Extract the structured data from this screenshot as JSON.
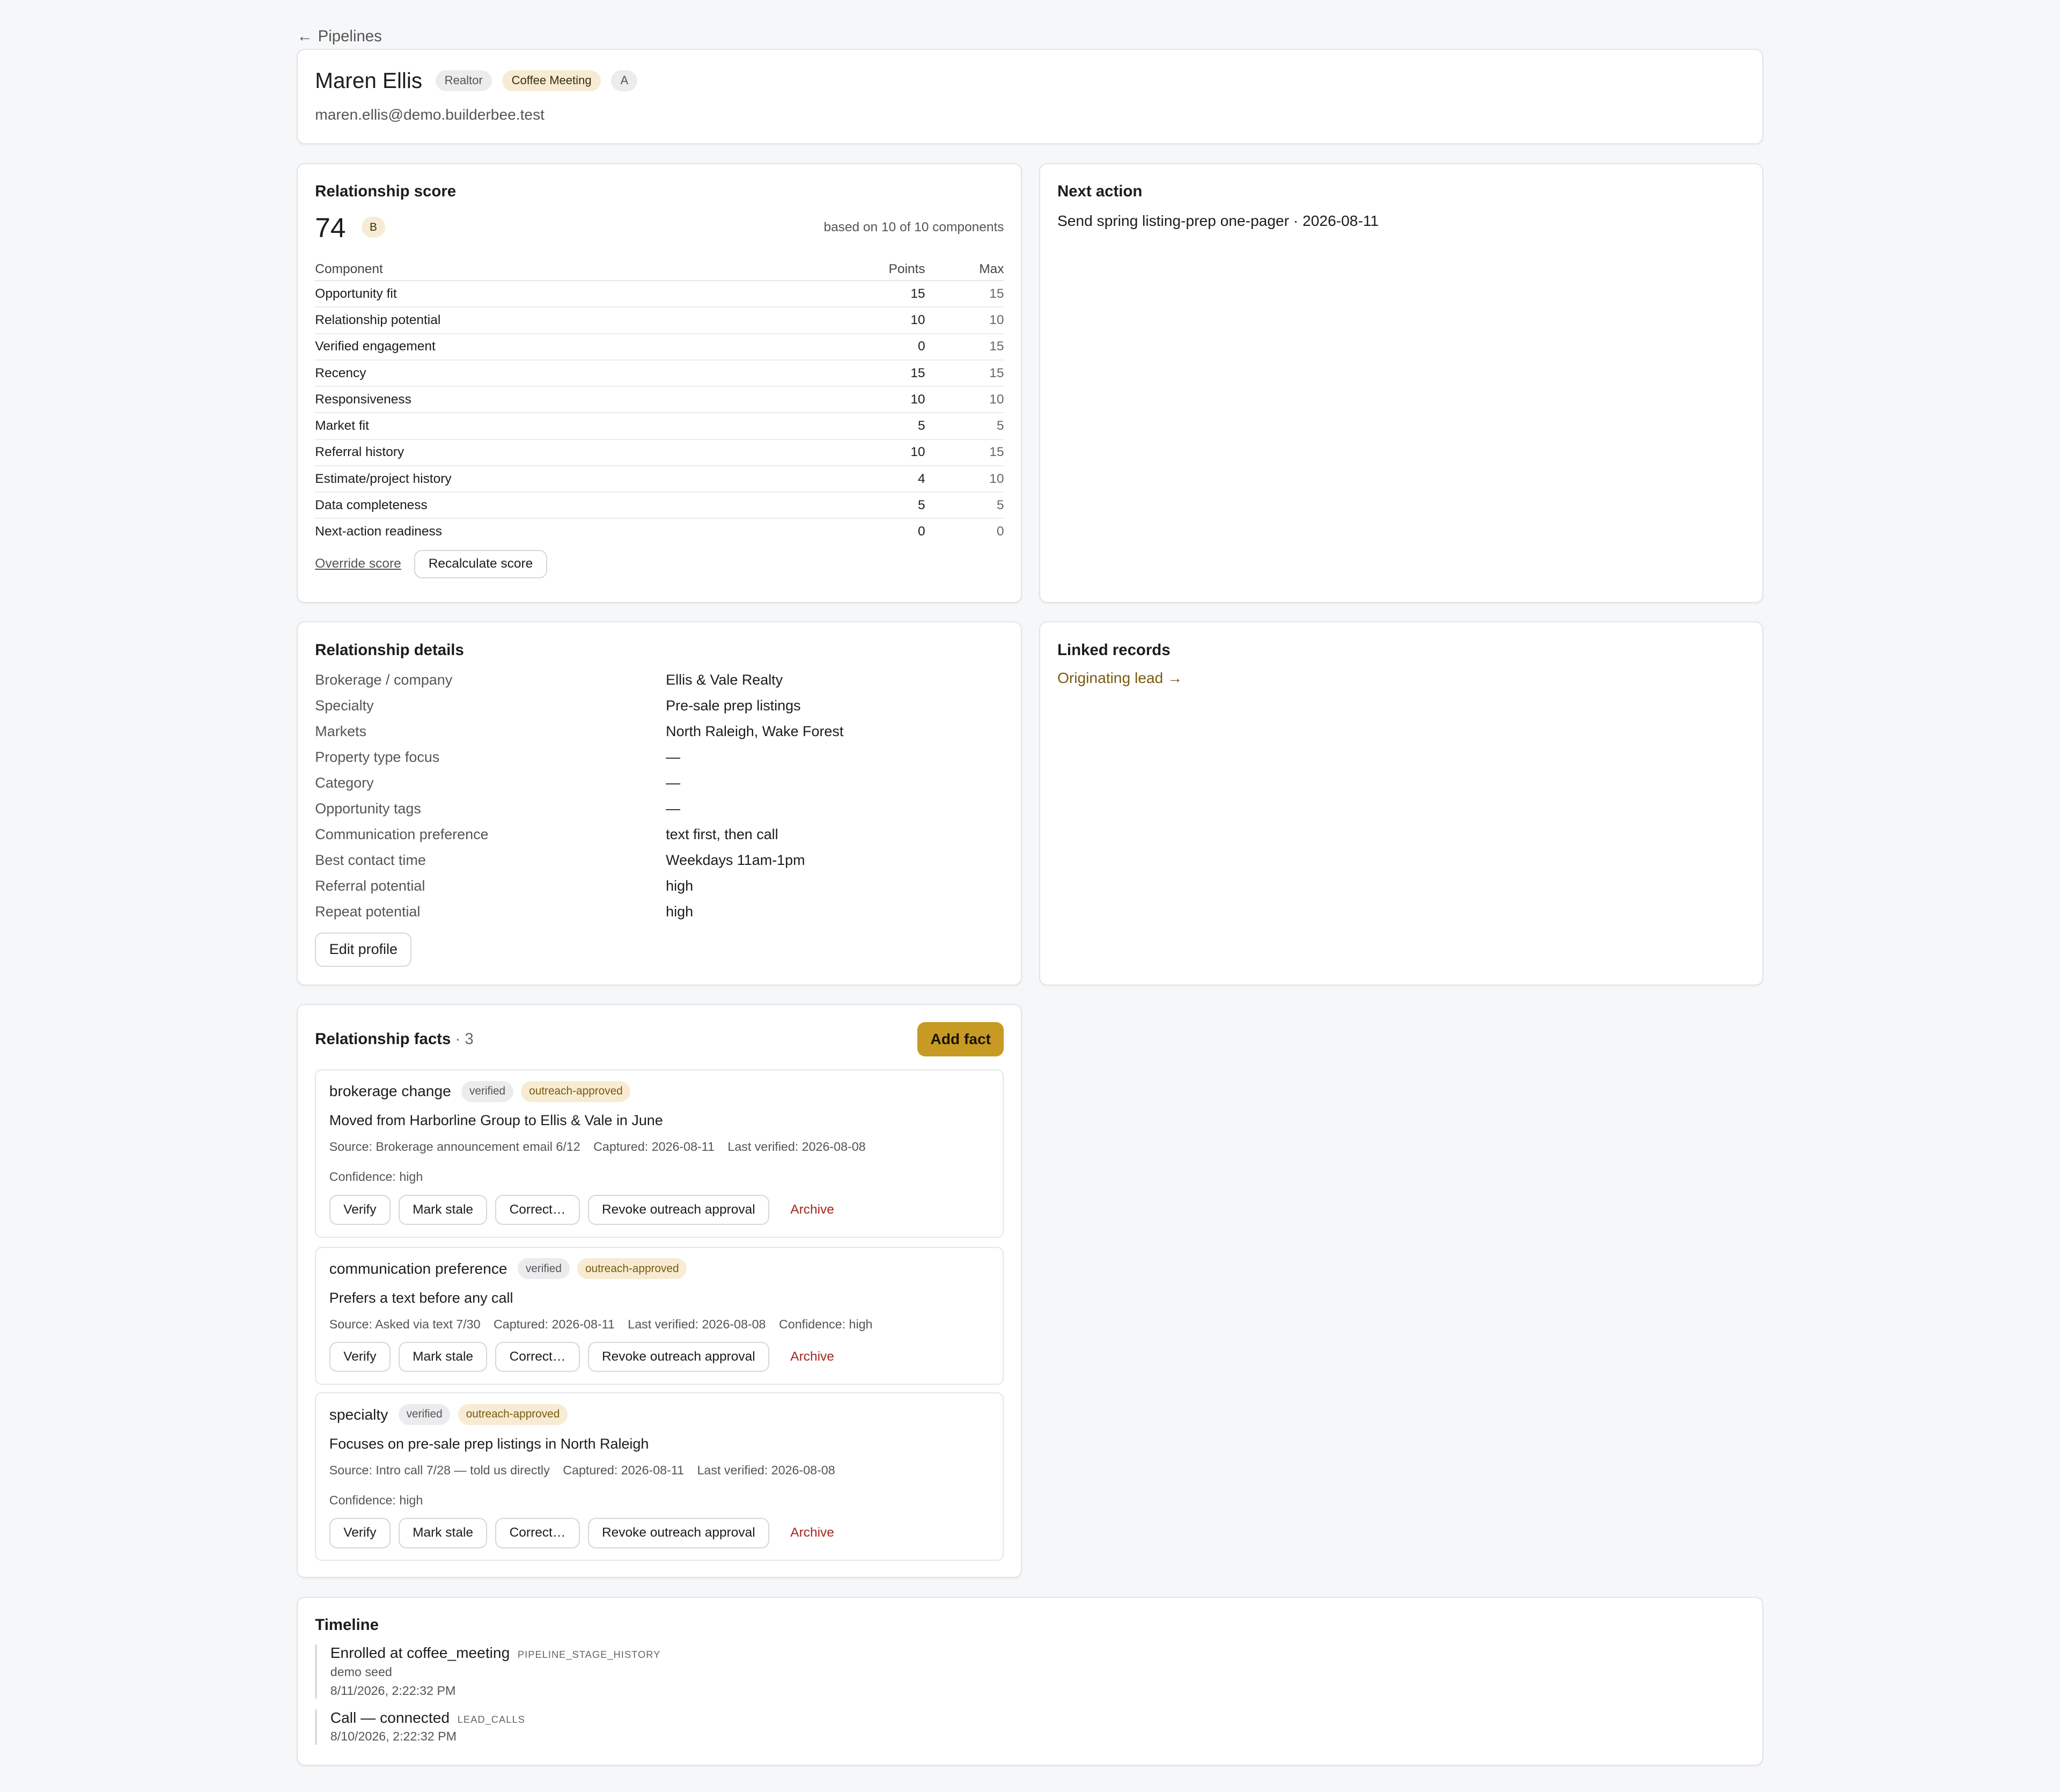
{
  "nav": {
    "back_label": "Pipelines",
    "back_icon": "arrow-left-icon"
  },
  "contact": {
    "name": "Maren Ellis",
    "role_badge": "Realtor",
    "stage_badge": "Coffee Meeting",
    "tier_badge": "A",
    "email": "maren.ellis@demo.builderbee.test"
  },
  "score": {
    "title": "Relationship score",
    "value": "74",
    "grade": "B",
    "based_on": "based on 10 of 10 components",
    "headers": {
      "component": "Component",
      "points": "Points",
      "max": "Max"
    },
    "rows": [
      {
        "component": "Opportunity fit",
        "points": "15",
        "max": "15"
      },
      {
        "component": "Relationship potential",
        "points": "10",
        "max": "10"
      },
      {
        "component": "Verified engagement",
        "points": "0",
        "max": "15"
      },
      {
        "component": "Recency",
        "points": "15",
        "max": "15"
      },
      {
        "component": "Responsiveness",
        "points": "10",
        "max": "10"
      },
      {
        "component": "Market fit",
        "points": "5",
        "max": "5"
      },
      {
        "component": "Referral history",
        "points": "10",
        "max": "15"
      },
      {
        "component": "Estimate/project history",
        "points": "4",
        "max": "10"
      },
      {
        "component": "Data completeness",
        "points": "5",
        "max": "5"
      },
      {
        "component": "Next-action readiness",
        "points": "0",
        "max": "0"
      }
    ],
    "override_label": "Override score",
    "recalculate_label": "Recalculate score"
  },
  "next_action": {
    "title": "Next action",
    "text": "Send spring listing-prep one-pager · 2026-08-11"
  },
  "details": {
    "title": "Relationship details",
    "rows": [
      {
        "label": "Brokerage / company",
        "value": "Ellis & Vale Realty"
      },
      {
        "label": "Specialty",
        "value": "Pre-sale prep listings"
      },
      {
        "label": "Markets",
        "value": "North Raleigh, Wake Forest"
      },
      {
        "label": "Property type focus",
        "value": "—"
      },
      {
        "label": "Category",
        "value": "—"
      },
      {
        "label": "Opportunity tags",
        "value": "—"
      },
      {
        "label": "Communication preference",
        "value": "text first, then call"
      },
      {
        "label": "Best contact time",
        "value": "Weekdays 11am-1pm"
      },
      {
        "label": "Referral potential",
        "value": "high"
      },
      {
        "label": "Repeat potential",
        "value": "high"
      }
    ],
    "edit_label": "Edit profile"
  },
  "linked": {
    "title": "Linked records",
    "link_label": "Originating lead →"
  },
  "facts": {
    "title": "Relationship facts",
    "count": "· 3",
    "add_label": "Add fact",
    "action_labels": {
      "verify": "Verify",
      "stale": "Mark stale",
      "correct": "Correct…",
      "revoke": "Revoke outreach approval",
      "archive": "Archive"
    },
    "items": [
      {
        "title": "brokerage change",
        "badge1": "verified",
        "badge2": "outreach-approved",
        "text": "Moved from Harborline Group to Ellis & Vale in June",
        "source": "Source: Brokerage announcement email 6/12",
        "captured": "Captured: 2026-08-11",
        "verified": "Last verified: 2026-08-08",
        "confidence": "Confidence: high"
      },
      {
        "title": "communication preference",
        "badge1": "verified",
        "badge2": "outreach-approved",
        "text": "Prefers a text before any call",
        "source": "Source: Asked via text 7/30",
        "captured": "Captured: 2026-08-11",
        "verified": "Last verified: 2026-08-08",
        "confidence": "Confidence: high"
      },
      {
        "title": "specialty",
        "badge1": "verified",
        "badge2": "outreach-approved",
        "text": "Focuses on pre-sale prep listings in North Raleigh",
        "source": "Source: Intro call 7/28 — told us directly",
        "captured": "Captured: 2026-08-11",
        "verified": "Last verified: 2026-08-08",
        "confidence": "Confidence: high"
      }
    ]
  },
  "timeline": {
    "title": "Timeline",
    "items": [
      {
        "title": "Enrolled at coffee_meeting",
        "tag": "PIPELINE_STAGE_HISTORY",
        "note": "demo seed",
        "time": "8/11/2026, 2:22:32 PM"
      },
      {
        "title": "Call — connected",
        "tag": "LEAD_CALLS",
        "time": "8/10/2026, 2:22:32 PM"
      }
    ]
  }
}
